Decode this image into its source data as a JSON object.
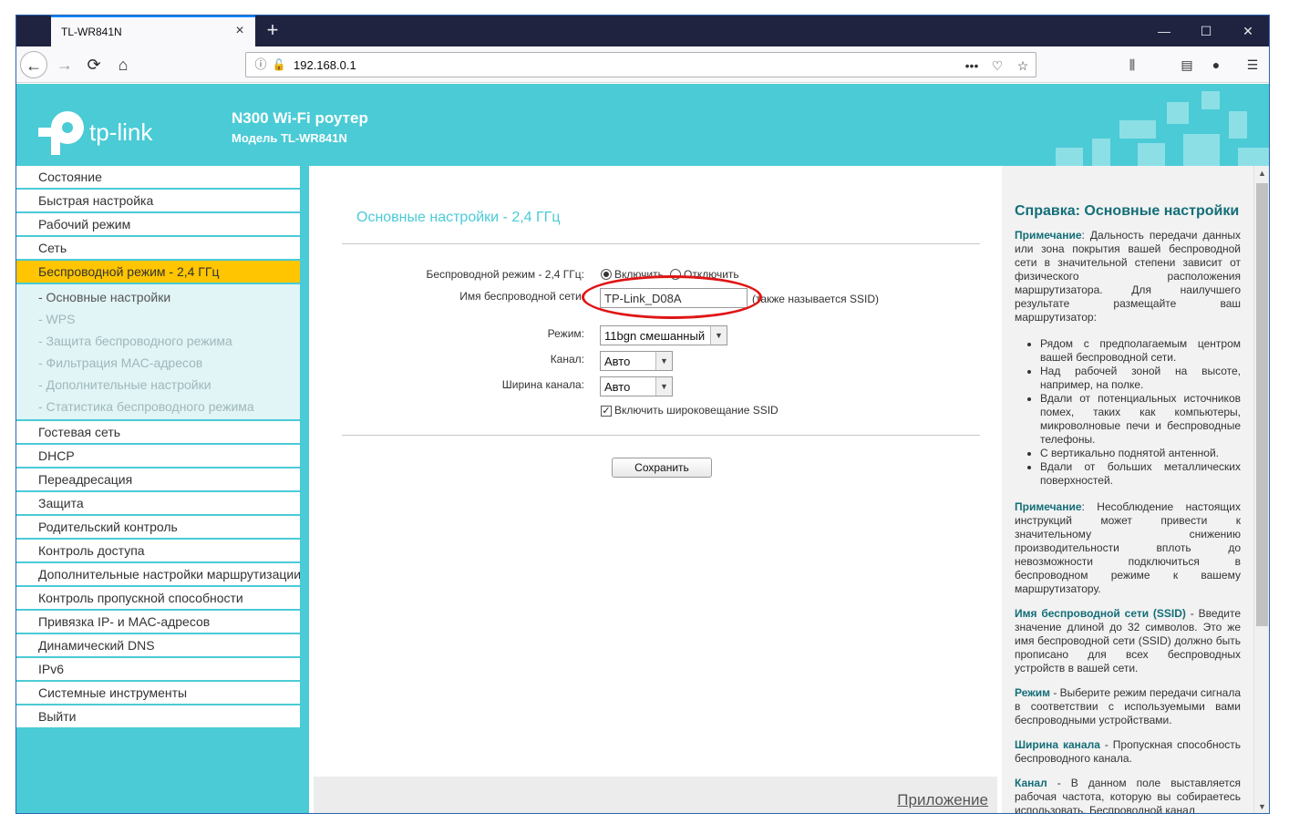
{
  "browser": {
    "tab_title": "TL-WR841N",
    "tab_close": "×",
    "new_tab": "+",
    "url": "192.168.0.1",
    "window_controls": {
      "minimize": "—",
      "maximize": "☐",
      "close": "✕"
    }
  },
  "header": {
    "logo_text": "tp-link",
    "product_title": "N300 Wi-Fi роутер",
    "model": "Модель TL-WR841N",
    "accent_color": "#4acbd6"
  },
  "sidebar": {
    "items_top": [
      "Состояние",
      "Быстрая настройка",
      "Рабочий режим",
      "Сеть"
    ],
    "active_item": "Беспроводной режим - 2,4 ГГц",
    "sub_items": [
      "- Основные настройки",
      "- WPS",
      "- Защита беспроводного режима",
      "- Фильтрация MAC-адресов",
      "- Дополнительные настройки",
      "- Статистика беспроводного режима"
    ],
    "items_bottom": [
      "Гостевая сеть",
      "DHCP",
      "Переадресация",
      "Защита",
      "Родительский контроль",
      "Контроль доступа",
      "Дополнительные настройки маршрутизации",
      "Контроль пропускной способности",
      "Привязка IP- и MAC-адресов",
      "Динамический DNS",
      "IPv6",
      "Системные инструменты",
      "Выйти"
    ]
  },
  "main": {
    "title": "Основные настройки - 2,4 ГГц",
    "wireless_label": "Беспроводной режим - 2,4 ГГц:",
    "enable_label": "Включить",
    "disable_label": "Отключить",
    "ssid_label": "Имя беспроводной сети:",
    "ssid_value": "TP-Link_D08A",
    "ssid_hint": "(также называется SSID)",
    "mode_label": "Режим:",
    "mode_value": "11bgn смешанный",
    "channel_label": "Канал:",
    "channel_value": "Авто",
    "width_label": "Ширина канала:",
    "width_value": "Авто",
    "broadcast_label": "Включить широковещание SSID",
    "save_label": "Сохранить",
    "footer_link": "Приложение"
  },
  "help": {
    "title": "Справка: Основные настройки",
    "note_term": "Примечание",
    "note1": ": Дальность передачи данных или зона покрытия вашей беспроводной сети в значительной степени зависит от физического расположения маршрутизатора. Для наилучшего результате размещайте ваш маршрутизатор:",
    "bullets": [
      "Рядом с предполагаемым центром вашей беспроводной сети.",
      "Над рабочей зоной на высоте, например, на полке.",
      "Вдали от потенциальных источников помех, таких как компьютеры, микроволновые печи и беспроводные телефоны.",
      "С вертикально поднятой антенной.",
      "Вдали от больших металлических поверхностей."
    ],
    "note2": ": Несоблюдение настоящих инструкций может привести к значительному снижению производительности вплоть до невозможности подключиться в беспроводном режиме к вашему маршрутизатору.",
    "ssid_term": "Имя беспроводной сети (SSID)",
    "ssid_text": " - Введите значение длиной до 32 символов. Это же имя беспроводной сети (SSID) должно быть прописано для всех беспроводных устройств в вашей сети.",
    "mode_term": "Режим",
    "mode_text": " - Выберите режим передачи сигнала в соответствии с используемыми вами беспроводными устройствами.",
    "width_term": "Ширина канала",
    "width_text": " - Пропускная способность беспроводного канала.",
    "channel_term": "Канал",
    "channel_text": " - В данном поле выставляется рабочая частота, которую вы собираетесь использовать. Беспроводной канал"
  }
}
